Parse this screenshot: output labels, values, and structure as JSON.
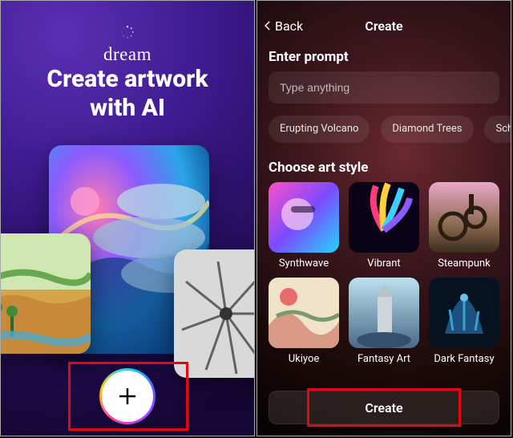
{
  "left": {
    "brand": "dream",
    "headline_line1": "Create artwork",
    "headline_line2": "with AI",
    "fab_icon": "plus-icon"
  },
  "right": {
    "nav": {
      "back": "Back",
      "title": "Create"
    },
    "prompt": {
      "section": "Enter prompt",
      "placeholder": "Type anything",
      "suggestions": [
        "Erupting Volcano",
        "Diamond Trees",
        "Sch"
      ]
    },
    "style": {
      "section": "Choose art style",
      "tiles": [
        "Synthwave",
        "Vibrant",
        "Steampunk",
        "Ukiyoe",
        "Fantasy Art",
        "Dark Fantasy"
      ]
    },
    "cta": "Create"
  }
}
